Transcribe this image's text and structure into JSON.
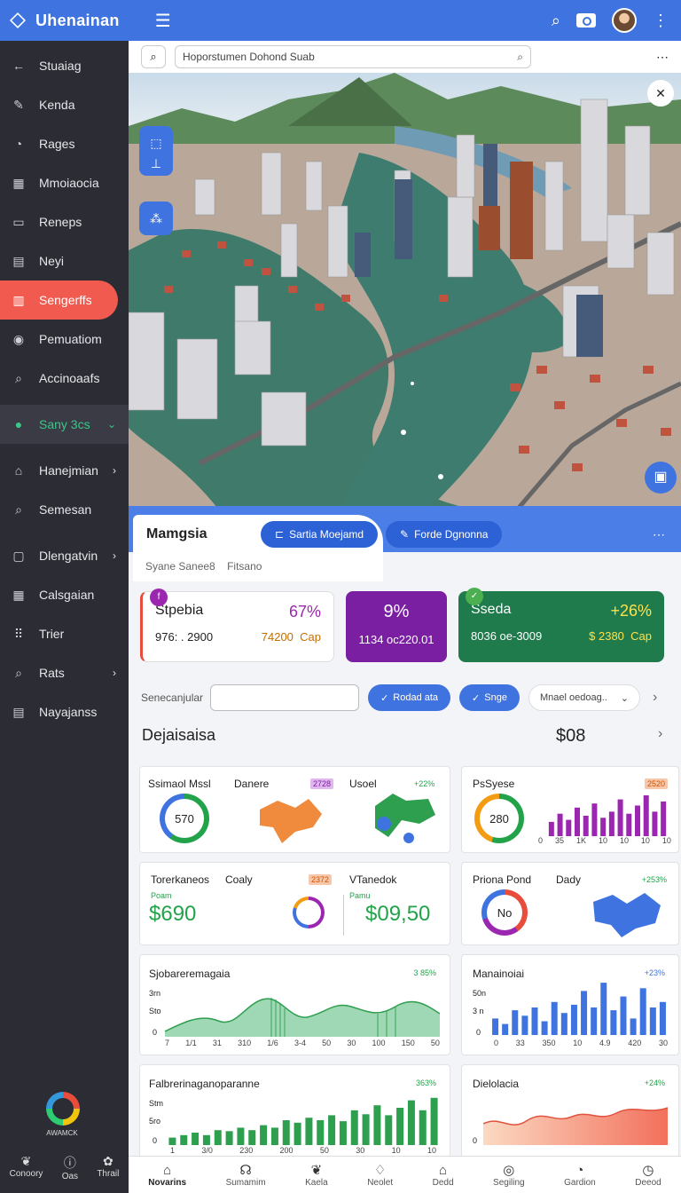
{
  "app": {
    "title": "Uhenainan"
  },
  "sidebar": {
    "items": [
      {
        "label": "Stuaiag",
        "icon": "arrow-left-icon"
      },
      {
        "label": "Kenda",
        "icon": "wrench-icon"
      },
      {
        "label": "Rages",
        "icon": "gauge-icon"
      },
      {
        "label": "Mmoiaocia",
        "icon": "grid-icon"
      },
      {
        "label": "Reneps",
        "icon": "monitor-icon"
      },
      {
        "label": "Neyi",
        "icon": "document-icon"
      },
      {
        "label": "Sengerffs",
        "icon": "table-icon"
      },
      {
        "label": "Pemuatiom",
        "icon": "circle-icon"
      },
      {
        "label": "Accinoaafs",
        "icon": "search-icon"
      },
      {
        "label": "Sany 3cs",
        "icon": "globe-icon"
      },
      {
        "label": "Hanejmian",
        "icon": "building-icon"
      },
      {
        "label": "Semesan",
        "icon": "search-icon"
      },
      {
        "label": "Dlengatvin",
        "icon": "square-icon"
      },
      {
        "label": "Calsgaian",
        "icon": "calendar-icon"
      },
      {
        "label": "Trier",
        "icon": "dots-grid-icon"
      },
      {
        "label": "Rats",
        "icon": "search-icon"
      },
      {
        "label": "Nayajanss",
        "icon": "clipboard-icon"
      }
    ],
    "brand_label": "AWAMCK",
    "bottom": [
      {
        "label": "Conoory",
        "icon": "leaf-icon"
      },
      {
        "label": "Oas",
        "icon": "info-icon"
      },
      {
        "label": "Thrail",
        "icon": "flower-icon"
      }
    ]
  },
  "search": {
    "placeholder": "Hoporstumen Dohond Suab"
  },
  "panel": {
    "tab": "Mamgsia",
    "chip1": "Sartia Moejamd",
    "chip2": "Forde Dgnonna",
    "sub1": "Syane Sanee8",
    "sub2": "Fitsano"
  },
  "stats": [
    {
      "title": "Stpebia",
      "value": "67%",
      "sub": "976: . 2900",
      "sub2": "74200",
      "sub3": "Cap",
      "dot": "f"
    },
    {
      "title": "",
      "value": "9%",
      "sub": "1134 oc220.01",
      "sub2": "",
      "sub3": "",
      "dot": ""
    },
    {
      "title": "Sseda",
      "value": "+26%",
      "sub": "8036 oe-3009",
      "sub2": "$ 2380",
      "sub3": "Cap",
      "dot": "✓"
    }
  ],
  "filter": {
    "label": "Senecanjular",
    "chip1": "Rodad ata",
    "chip2": "Snge",
    "select": "Mnael oedoag.."
  },
  "section": {
    "title": "Dejaisaisa",
    "value": "$08"
  },
  "cards": {
    "c1": {
      "t1": "Ssimaol Mssl",
      "t2": "Danere",
      "b2": "2728",
      "t3": "Usoel",
      "b3": "+22%",
      "gauge": "570"
    },
    "c2": {
      "t1": "PsSyese",
      "b1": "2520",
      "gauge": "280",
      "xaxis": [
        "0",
        "35",
        "1K",
        "10",
        "10",
        "10",
        "10"
      ]
    },
    "c3": {
      "t1": "Torerkaneos",
      "t2": "Coaly",
      "b2": "2372",
      "t3": "VTanedok",
      "s1": "Poam",
      "v1": "$690",
      "s3": "Pamu",
      "v3": "$09,50"
    },
    "c4": {
      "t1": "Priona Pond",
      "t2": "Dady",
      "b2": "+253%",
      "gauge": "No"
    },
    "c5": {
      "t1": "Sjobareremagaia",
      "b1": "3 85%",
      "y1": "3rn",
      "y2": "Sto",
      "y3": "0",
      "xaxis": [
        "7",
        "1/1",
        "31",
        "310",
        "1/6",
        "3-4",
        "50",
        "30",
        "100",
        "150",
        "50"
      ]
    },
    "c6": {
      "t1": "Manainoiai",
      "b1": "+23%",
      "y1": "50n",
      "y2": "3 n",
      "y3": "0",
      "xaxis": [
        "0",
        "33",
        "350",
        "10",
        "4.9",
        "420",
        "30"
      ]
    },
    "c7": {
      "t1": "Falbrerinaganoparanne",
      "b1": "363%",
      "y1": "Stm",
      "y2": "5ro",
      "y3": "0",
      "xaxis": [
        "1",
        "3/0",
        "230",
        "200",
        "50",
        "30",
        "10",
        "10"
      ]
    },
    "c8": {
      "t1": "Dielolacia",
      "b1": "+24%",
      "y1": "0"
    }
  },
  "bottomnav": [
    {
      "label": "Novarins",
      "icon": "home-icon"
    },
    {
      "label": "Sumamim",
      "icon": "headset-icon"
    },
    {
      "label": "Kaela",
      "icon": "leaf-icon"
    },
    {
      "label": "Neolet",
      "icon": "bell-icon"
    },
    {
      "label": "Dedd",
      "icon": "house-outline-icon"
    },
    {
      "label": "Segiling",
      "icon": "target-icon"
    },
    {
      "label": "Gardion",
      "icon": "gauge-icon"
    },
    {
      "label": "Deeod",
      "icon": "clock-icon"
    }
  ],
  "colors": {
    "primary": "#3f74e0",
    "sidebar": "#2b2c34",
    "active": "#f05a4f",
    "purple": "#7b1fa2",
    "green": "#1f7a4c"
  }
}
